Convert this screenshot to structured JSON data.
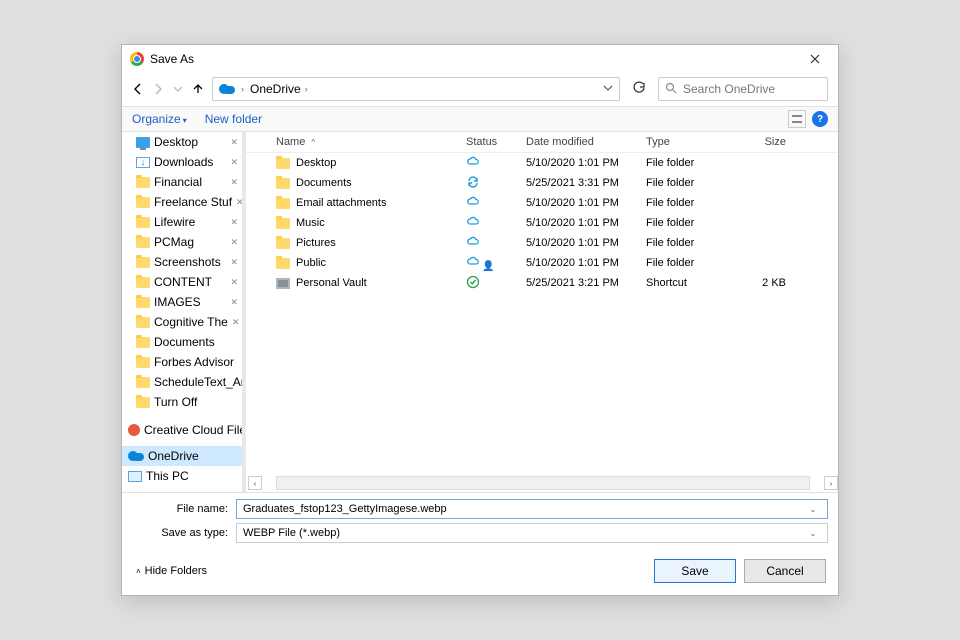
{
  "title": "Save As",
  "breadcrumb": {
    "location": "OneDrive"
  },
  "search": {
    "placeholder": "Search OneDrive"
  },
  "toolbar": {
    "organize": "Organize",
    "newfolder": "New folder"
  },
  "columns": {
    "name": "Name",
    "status": "Status",
    "date": "Date modified",
    "type": "Type",
    "size": "Size"
  },
  "sidebar": {
    "items": [
      {
        "label": "Desktop",
        "icon": "desktop",
        "pinned": true
      },
      {
        "label": "Downloads",
        "icon": "downloads",
        "pinned": true
      },
      {
        "label": "Financial",
        "icon": "folder",
        "pinned": true
      },
      {
        "label": "Freelance Stuf",
        "icon": "folder",
        "pinned": true
      },
      {
        "label": "Lifewire",
        "icon": "folder",
        "pinned": true
      },
      {
        "label": "PCMag",
        "icon": "folder",
        "pinned": true
      },
      {
        "label": "Screenshots",
        "icon": "folder",
        "pinned": true
      },
      {
        "label": "CONTENT",
        "icon": "folder",
        "pinned": true
      },
      {
        "label": "IMAGES",
        "icon": "folder",
        "pinned": true
      },
      {
        "label": "Cognitive The",
        "icon": "folder",
        "pinned": true
      },
      {
        "label": "Documents",
        "icon": "folder",
        "pinned": false
      },
      {
        "label": "Forbes Advisor",
        "icon": "folder",
        "pinned": false
      },
      {
        "label": "ScheduleText_An",
        "icon": "folder",
        "pinned": false
      },
      {
        "label": "Turn Off",
        "icon": "folder",
        "pinned": false
      }
    ],
    "roots": [
      {
        "label": "Creative Cloud File",
        "icon": "cc"
      },
      {
        "label": "OneDrive",
        "icon": "onedrive",
        "selected": true
      },
      {
        "label": "This PC",
        "icon": "pc"
      }
    ]
  },
  "files": [
    {
      "name": "Desktop",
      "status": "cloud",
      "date": "5/10/2020 1:01 PM",
      "type": "File folder",
      "size": ""
    },
    {
      "name": "Documents",
      "status": "sync",
      "date": "5/25/2021 3:31 PM",
      "type": "File folder",
      "size": ""
    },
    {
      "name": "Email attachments",
      "status": "cloud",
      "date": "5/10/2020 1:01 PM",
      "type": "File folder",
      "size": ""
    },
    {
      "name": "Music",
      "status": "cloud",
      "date": "5/10/2020 1:01 PM",
      "type": "File folder",
      "size": ""
    },
    {
      "name": "Pictures",
      "status": "cloud",
      "date": "5/10/2020 1:01 PM",
      "type": "File folder",
      "size": ""
    },
    {
      "name": "Public",
      "status": "cloud-shared",
      "date": "5/10/2020 1:01 PM",
      "type": "File folder",
      "size": ""
    },
    {
      "name": "Personal Vault",
      "status": "check",
      "date": "5/25/2021 3:21 PM",
      "type": "Shortcut",
      "size": "2 KB",
      "icon": "vault"
    }
  ],
  "fields": {
    "filename_label": "File name:",
    "filename_value": "Graduates_fstop123_GettyImagese.webp",
    "saveas_label": "Save as type:",
    "saveas_value": "WEBP File (*.webp)"
  },
  "footer": {
    "hide": "Hide Folders",
    "save": "Save",
    "cancel": "Cancel"
  }
}
